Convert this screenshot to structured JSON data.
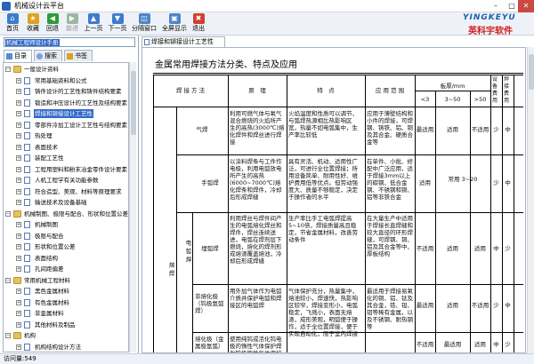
{
  "window": {
    "title": "机械设计云平台"
  },
  "toolbar": {
    "buttons": [
      {
        "label": "首页",
        "icon": "home-icon"
      },
      {
        "label": "收藏",
        "icon": "favorites-icon"
      },
      {
        "label": "回退",
        "icon": "back-icon"
      },
      {
        "label": "前进",
        "icon": "forward-icon"
      },
      {
        "label": "上一页",
        "icon": "prev-page-icon"
      },
      {
        "label": "下一页",
        "icon": "next-page-icon"
      },
      {
        "label": "分隔窗口",
        "icon": "split-window-icon"
      },
      {
        "label": "全屏显示",
        "icon": "fullscreen-icon"
      },
      {
        "label": "退出",
        "icon": "exit-icon"
      }
    ]
  },
  "logo": {
    "line1": "YINGKEYU",
    "line2": "英科宇软件"
  },
  "sidebar": {
    "search_value": "机械工程师设计手册",
    "tabs": [
      {
        "label": "目录"
      },
      {
        "label": "搜索"
      },
      {
        "label": "书签"
      }
    ],
    "tree": [
      {
        "label": "一般设计资料",
        "level": 0,
        "expanded": true
      },
      {
        "label": "常用基础资料和公式",
        "level": 1
      },
      {
        "label": "铸件设计的工艺性和铸件结构要素",
        "level": 1
      },
      {
        "label": "锻造和冲压设计的工艺性及结构要素",
        "level": 1
      },
      {
        "label": "焊接和铆接设计工艺性",
        "level": 1,
        "selected": true
      },
      {
        "label": "零部件冷加工设计工艺性与结构要素",
        "level": 1
      },
      {
        "label": "热处理",
        "level": 1
      },
      {
        "label": "表面技术",
        "level": 1
      },
      {
        "label": "装配工艺性",
        "level": 1
      },
      {
        "label": "工程用塑料和粉末冶金零件设计要素",
        "level": 1
      },
      {
        "label": "人机工程学有关功能参数",
        "level": 1
      },
      {
        "label": "符合造型、美观、材料等原理要求",
        "level": 1
      },
      {
        "label": "输送技术及设备基础",
        "level": 1
      },
      {
        "label": "机械制图、极限与配合、形状和位置公差",
        "level": 0,
        "expanded": true
      },
      {
        "label": "机械制图",
        "level": 1
      },
      {
        "label": "极限与配合",
        "level": 1
      },
      {
        "label": "形状和位置公差",
        "level": 1
      },
      {
        "label": "表面结构",
        "level": 1
      },
      {
        "label": "孔间距偏差",
        "level": 1
      },
      {
        "label": "常用机械工程材料",
        "level": 0,
        "expanded": true
      },
      {
        "label": "黑色金属材料",
        "level": 1
      },
      {
        "label": "有色金属材料",
        "level": 1
      },
      {
        "label": "非金属材料",
        "level": 1
      },
      {
        "label": "其他材料及制品",
        "level": 1
      },
      {
        "label": "机构",
        "level": 0,
        "expanded": true
      },
      {
        "label": "机构结构设计方法",
        "level": 1
      }
    ]
  },
  "document": {
    "tab_label": "焊接和铆接设计工艺性",
    "title": "金属常用焊接方法分类、特点及应用",
    "headers": {
      "method": "焊 接 方 法",
      "principle": "原　理",
      "features": "特　点",
      "application": "应 用 范 围",
      "thickness": "板厚/mm",
      "t_lt3": "<3",
      "t_3to50": "3~50",
      "t_gt50": ">50",
      "equipment_cost": "设备费用",
      "welding_cost": "焊接费用"
    },
    "rows": {
      "gas_name": "气焊",
      "gas_principle": "利用可燃气体与氧气混合燃烧的火焰所产生的高热(3000℃)熔化焊件和焊丝进行焊接",
      "gas_features": "火焰温度和性质可以调节，与弧焊热源相比热影响区宽，热量不如电弧集中，生产率比较低",
      "gas_application": "应用于薄壁结构和小件的焊接，可焊钢、铸铁、铝、铜及其合金、硬质合金等",
      "gas_t1": "最适用",
      "gas_t2": "适用",
      "gas_t3": "不适用",
      "gas_eq": "少",
      "gas_cost": "中",
      "manual_name": "手弧焊",
      "manual_principle": "以涂料焊条与工件作电极，利用电弧放电所产生的高热(6000~7000℃)熔化焊条和焊件，冷却后形成焊缝",
      "manual_features": "具有灵活、机动、适用性广泛，可进行全位置焊接；所用设备简单、耐用性好、维护费用低等优点。但劳动强度大、质量不够稳定，决定于操作者的水平",
      "manual_application": "在单件、小批、修配中广泛应用，适于焊接3mm以上的碳钢、低合金钢、不锈钢和铜、铝等非铁合金",
      "manual_t1": "适用",
      "manual_t23": "常用 3~20",
      "manual_eq": "少",
      "manual_cost": "中",
      "submerged_name": "埋弧焊",
      "submerged_principle": "利用焊丝与焊件间产生的电弧熔化焊丝和焊件，焊丝连续送进，电弧在焊剂层下燃烧，熔化的焊剂形成熔渣覆盖熔池，冷却后形成焊缝",
      "submerged_features": "生产率比手工电弧焊提高5~10倍，焊接质量高且稳定，节省金属材料，改善劳动条件",
      "submerged_application": "在大量生产中适用于焊接长直焊缝和较大直径的环形焊缝，可焊钢、铜、铝及其合金等中、厚板结构",
      "submerged_t1": "不适用",
      "submerged_t2": "适用",
      "submerged_t3": "适用",
      "submerged_eq": "中",
      "submerged_cost": "少",
      "group_main": "熔焊",
      "group_sub": "电弧焊",
      "tig_name": "非熔化极（钨极氩弧焊）",
      "tig_principle": "用外加气体作为电弧介质并保护电弧和焊接区的电弧焊",
      "tig_features": "气体保护充分，热量集中，熔池较小，焊速快，热影响区较窄，焊接变形小，电弧稳定，飞溅小，表面无熔渣，成形美观，明弧便于操作，适于全位置焊接，便于实现自动化，限于室内焊接",
      "tig_application": "最适用于焊接易氧化的铜、铝、钛及其合金，锆、钽、钼等稀有金属，以及不锈钢、耐热钢等",
      "tig_t1": "最适用",
      "tig_t2": "适用",
      "tig_t3": "不适用",
      "tig_eq": "少",
      "tig_cost": "中",
      "mig_name": "熔化极（金属极氩弧）",
      "mig_principle": "使用纯钨或活化钨电极的惰性气体保护焊为钨极惰性气体保护焊",
      "mig_t1": "不适用",
      "mig_t2": "最适用",
      "mig_t3": "适用",
      "mig_eq": "中",
      "mig_cost": "少"
    }
  },
  "status": {
    "text": "访问量:549"
  }
}
